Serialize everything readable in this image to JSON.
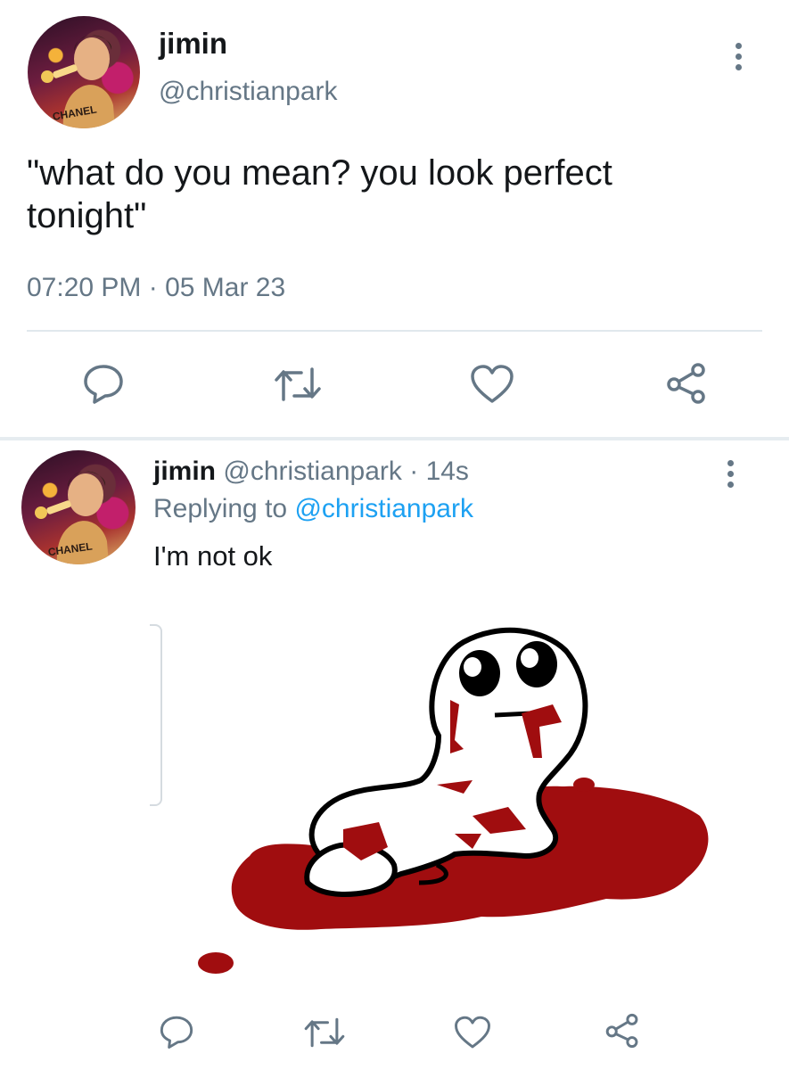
{
  "main_tweet": {
    "display_name": "jimin",
    "handle": "@christianpark",
    "text": "\"what do you mean? you look perfect tonight\"",
    "time": "07:20 PM",
    "date_sep": " · ",
    "date": "05 Mar 23",
    "avatar_shirt_text": "CHANEL"
  },
  "reply_tweet": {
    "display_name": "jimin",
    "handle": "@christianpark",
    "age_sep": " · ",
    "age": "14s",
    "replying_prefix": "Replying to ",
    "replying_to": "@christianpark",
    "text": "I'm not ok",
    "avatar_shirt_text": "CHANEL"
  },
  "actions": [
    "reply-icon",
    "retweet-icon",
    "like-icon",
    "share-icon"
  ],
  "colors": {
    "text": "#14171a",
    "secondary": "#657786",
    "link": "#1da1f2",
    "blood": "#a00d0f",
    "divider": "#e1e8ed"
  }
}
